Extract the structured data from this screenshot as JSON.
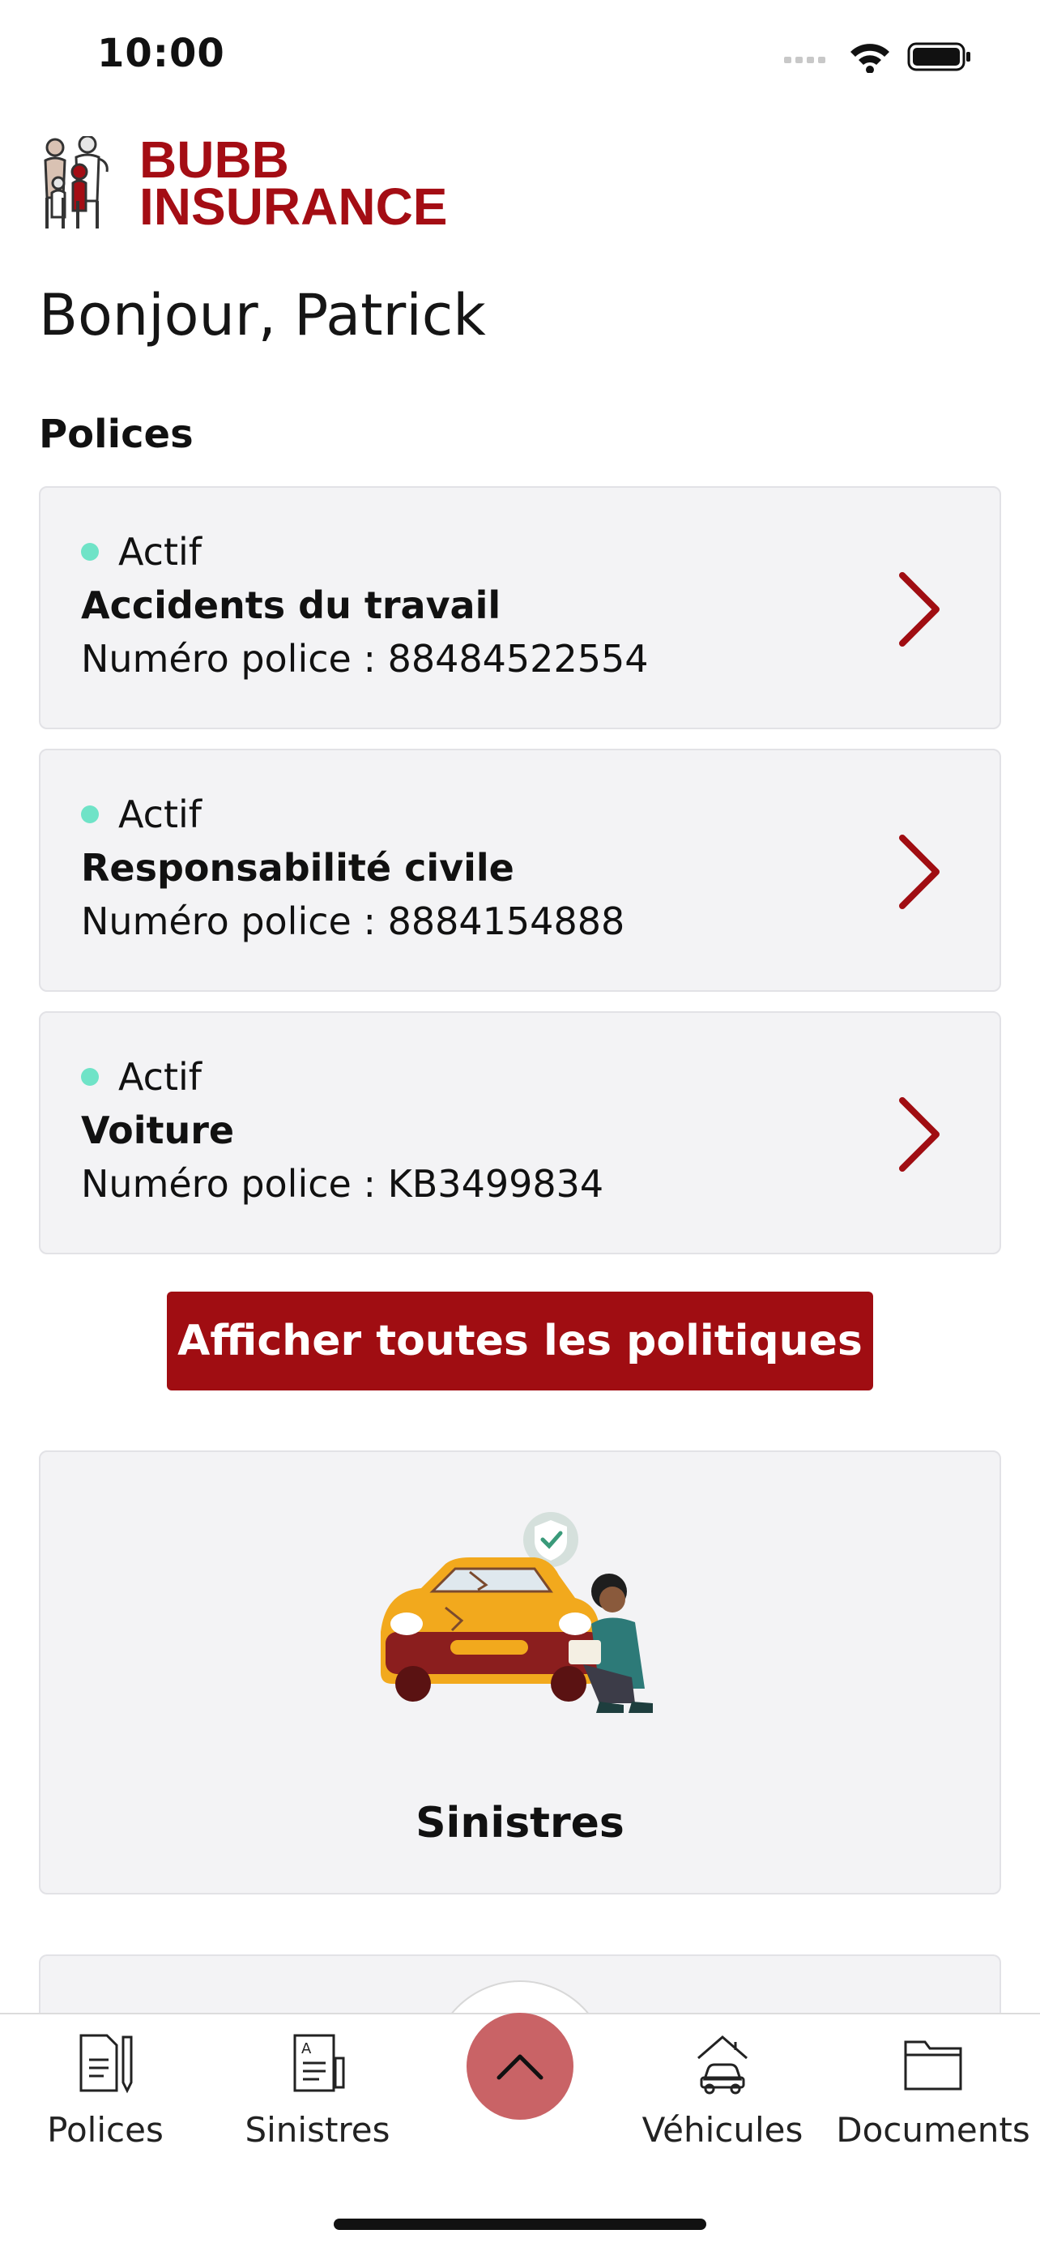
{
  "status_bar": {
    "time": "10:00"
  },
  "brand": {
    "name_line1": "BUBB",
    "name_line2": "INSURANCE",
    "color": "#a40d14"
  },
  "greeting": "Bonjour, Patrick",
  "policies_section": {
    "title": "Polices",
    "items": [
      {
        "status": "Actif",
        "name": "Accidents du travail",
        "number": "Numéro police : 88484522554"
      },
      {
        "status": "Actif",
        "name": "Responsabilité civile",
        "number": "Numéro police : 8884154888"
      },
      {
        "status": "Actif",
        "name": "Voiture",
        "number": "Numéro police : KB3499834"
      }
    ],
    "show_all_label": "Afficher toutes les politiques"
  },
  "claims_card": {
    "label": "Sinistres"
  },
  "tab_bar": {
    "items": [
      {
        "label": "Polices",
        "icon": "policy-document-icon"
      },
      {
        "label": "Sinistres",
        "icon": "claims-document-icon"
      },
      {
        "label": "Véhicules",
        "icon": "car-house-icon"
      },
      {
        "label": "Documents",
        "icon": "folder-icon"
      }
    ],
    "center_icon": "chevron-up-icon"
  },
  "colors": {
    "accent": "#a00d12",
    "status_active": "#6fe3c7",
    "card_bg": "#f3f3f5",
    "center_button": "#c96366"
  }
}
